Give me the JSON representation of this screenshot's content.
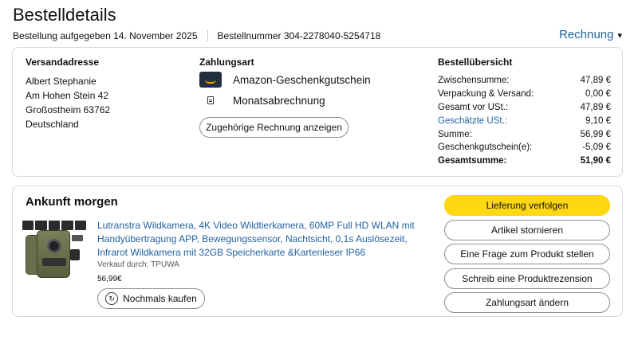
{
  "header": {
    "title": "Bestelldetails",
    "order_date": "Bestellung aufgegeben 14. November 2025",
    "order_number": "Bestellnummer 304-2278040-5254718",
    "invoice_label": "Rechnung"
  },
  "shipping": {
    "heading": "Versandadresse",
    "name": "Albert Stephanie",
    "street": "Am Hohen Stein 42",
    "city": "Großostheim 63762",
    "country": "Deutschland"
  },
  "payment": {
    "heading": "Zahlungsart",
    "methods": [
      {
        "icon": "amazon-gift-card-icon",
        "label": "Amazon-Geschenkgutschein"
      },
      {
        "icon": "invoice-document-icon",
        "label": "Monatsabrechnung"
      }
    ],
    "related_invoice_button": "Zugehörige Rechnung anzeigen"
  },
  "summary": {
    "heading": "Bestellübersicht",
    "rows": [
      {
        "label": "Zwischensumme:",
        "value": "47,89 €"
      },
      {
        "label": "Verpackung & Versand:",
        "value": "0,00 €"
      },
      {
        "label": "Gesamt vor USt.:",
        "value": "47,89 €"
      },
      {
        "label": "Geschätzte USt.:",
        "value": "9,10 €"
      },
      {
        "label": "Summe:",
        "value": "56,99 €"
      },
      {
        "label": "Geschenkgutschein(e):",
        "value": "-5,09 €"
      },
      {
        "label": "Gesamtsumme:",
        "value": "51,90 €"
      }
    ]
  },
  "shipment": {
    "arrival": "Ankunft morgen",
    "product_title": "Lutranstra Wildkamera, 4K Video Wildtierkamera, 60MP Full HD WLAN mit Handyübertragung APP, Bewegungssensor, Nachtsicht, 0,1s Auslösezeit, Infrarot Wildkamera mit 32GB Speicherkarte &Kartenleser IP66",
    "seller": "Verkauf durch: TPUWA",
    "price": "56,99€",
    "rebuy_button": "Nochmals kaufen",
    "actions": {
      "track": "Lieferung verfolgen",
      "cancel": "Artikel stornieren",
      "question": "Eine Frage zum Produkt stellen",
      "review": "Schreib eine Produktrezension",
      "change_payment": "Zahlungsart ändern"
    }
  },
  "colors": {
    "link": "#2162a1",
    "primary_button": "#ffd814",
    "border": "#d5d9d9"
  }
}
